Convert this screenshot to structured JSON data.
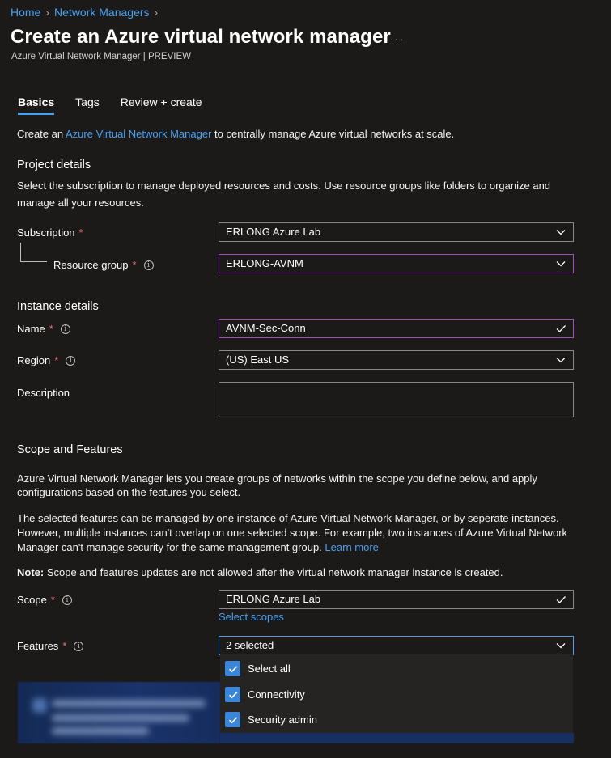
{
  "breadcrumb": {
    "home": "Home",
    "network_managers": "Network Managers"
  },
  "page": {
    "title": "Create an Azure virtual network manager",
    "more": "···",
    "subtitle": "Azure Virtual Network Manager | PREVIEW"
  },
  "tabs": [
    {
      "label": "Basics",
      "active": true
    },
    {
      "label": "Tags",
      "active": false
    },
    {
      "label": "Review + create",
      "active": false
    }
  ],
  "intro": {
    "prefix": "Create an ",
    "link": "Azure Virtual Network Manager",
    "suffix": " to centrally manage Azure virtual networks at scale."
  },
  "project_details": {
    "heading": "Project details",
    "description": "Select the subscription to manage deployed resources and costs. Use resource groups like folders to organize and manage all your resources.",
    "subscription_label": "Subscription",
    "subscription_value": "ERLONG Azure Lab",
    "resource_group_label": "Resource group",
    "resource_group_value": "ERLONG-AVNM"
  },
  "instance_details": {
    "heading": "Instance details",
    "name_label": "Name",
    "name_value": "AVNM-Sec-Conn",
    "region_label": "Region",
    "region_value": "(US) East US",
    "description_label": "Description",
    "description_value": ""
  },
  "scope_features": {
    "heading": "Scope and Features",
    "para1": "Azure Virtual Network Manager lets you create groups of networks within the scope you define below, and apply configurations based on the features you select.",
    "para2_line1": "The selected features can be managed by one instance of Azure Virtual Network Manager, or by seperate instances.",
    "para2_line2": "However, multiple instances can't overlap on one selected scope. For example, two instances of Azure Virtual Network",
    "para2_line3": "Manager can't manage security for the same management group. ",
    "learn_more": "Learn more",
    "note_bold": "Note:",
    "note_text": " Scope and features updates are not allowed after the virtual network manager instance is created.",
    "scope_label": "Scope",
    "scope_value": "ERLONG Azure Lab",
    "select_scopes": "Select scopes",
    "features_label": "Features",
    "features_value": "2 selected",
    "options": [
      {
        "label": "Select all",
        "checked": true
      },
      {
        "label": "Connectivity",
        "checked": true
      },
      {
        "label": "Security admin",
        "checked": true
      }
    ]
  },
  "required_marker": "*",
  "info_glyph": "i",
  "colors": {
    "accent": "#4aa0f0",
    "required": "#f1707b",
    "focus_border": "#a24ec7",
    "checkbox": "#3b86d8"
  }
}
